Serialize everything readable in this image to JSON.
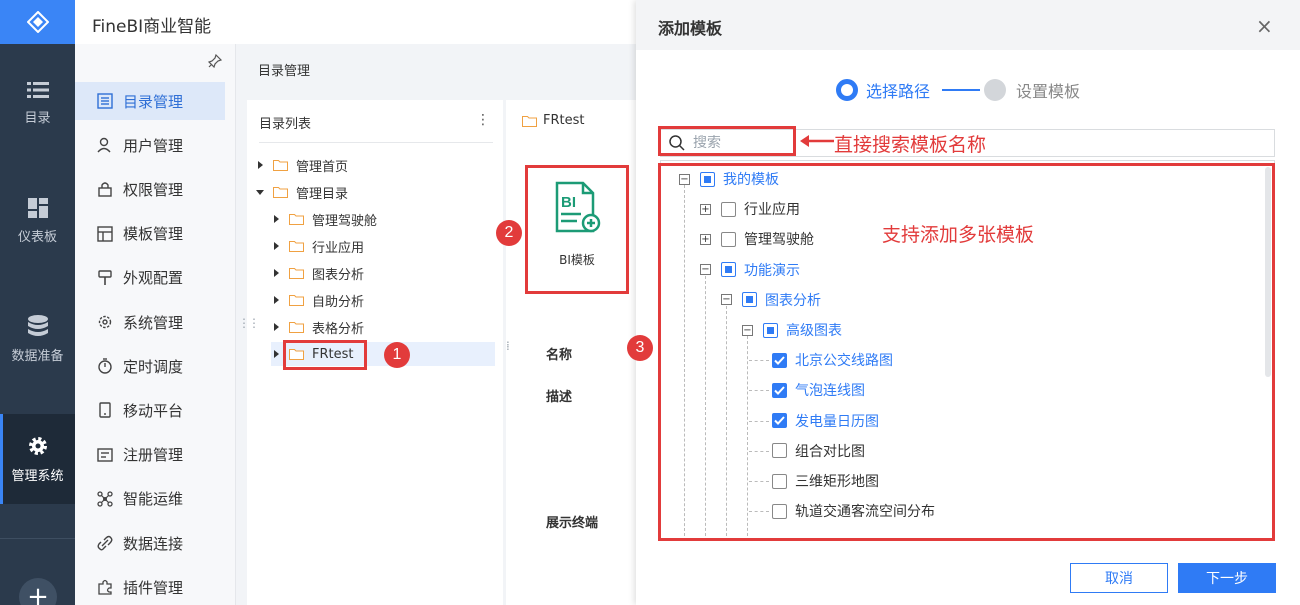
{
  "app": {
    "title": "FineBI商业智能"
  },
  "leftnav": {
    "items": [
      {
        "label": "目录",
        "icon": "list-icon"
      },
      {
        "label": "仪表板",
        "icon": "dashboard-icon"
      },
      {
        "label": "数据准备",
        "icon": "database-icon"
      },
      {
        "label": "管理系统",
        "icon": "gear-icon",
        "active": true
      }
    ],
    "add_label": "+"
  },
  "sidebar": {
    "items": [
      {
        "label": "目录管理",
        "icon": "catalog-icon",
        "active": true
      },
      {
        "label": "用户管理",
        "icon": "user-icon"
      },
      {
        "label": "权限管理",
        "icon": "lock-icon"
      },
      {
        "label": "模板管理",
        "icon": "template-icon"
      },
      {
        "label": "外观配置",
        "icon": "paint-icon"
      },
      {
        "label": "系统管理",
        "icon": "settings-icon"
      },
      {
        "label": "定时调度",
        "icon": "timer-icon"
      },
      {
        "label": "移动平台",
        "icon": "mobile-icon"
      },
      {
        "label": "注册管理",
        "icon": "register-icon"
      },
      {
        "label": "智能运维",
        "icon": "ops-icon"
      },
      {
        "label": "数据连接",
        "icon": "link-icon"
      },
      {
        "label": "插件管理",
        "icon": "plugin-icon"
      }
    ]
  },
  "main": {
    "breadcrumb": "目录管理",
    "list_title": "目录列表",
    "tree": [
      {
        "label": "管理首页",
        "level": 0,
        "expanded": false
      },
      {
        "label": "管理目录",
        "level": 0,
        "expanded": true
      },
      {
        "label": "管理驾驶舱",
        "level": 1,
        "expanded": false
      },
      {
        "label": "行业应用",
        "level": 1,
        "expanded": false
      },
      {
        "label": "图表分析",
        "level": 1,
        "expanded": false
      },
      {
        "label": "自助分析",
        "level": 1,
        "expanded": false
      },
      {
        "label": "表格分析",
        "level": 1,
        "expanded": false
      },
      {
        "label": "FRtest",
        "level": 1,
        "expanded": false,
        "selected": true
      }
    ],
    "detail": {
      "folder_name": "FRtest",
      "card_label": "BI模板",
      "field_name": "名称",
      "field_desc": "描述",
      "field_terminal": "展示终端"
    }
  },
  "dialog": {
    "title": "添加模板",
    "close_label": "×",
    "steps": [
      "选择路径",
      "设置模板"
    ],
    "search_placeholder": "搜索",
    "tree": [
      {
        "label": "我的模板",
        "level": 0,
        "toggle": "minus",
        "state": "partial",
        "blue": true
      },
      {
        "label": "行业应用",
        "level": 1,
        "toggle": "plus",
        "state": "unchecked"
      },
      {
        "label": "管理驾驶舱",
        "level": 1,
        "toggle": "plus",
        "state": "unchecked"
      },
      {
        "label": "功能演示",
        "level": 1,
        "toggle": "minus",
        "state": "partial",
        "blue": true
      },
      {
        "label": "图表分析",
        "level": 2,
        "toggle": "minus",
        "state": "partial",
        "blue": true
      },
      {
        "label": "高级图表",
        "level": 3,
        "toggle": "minus",
        "state": "partial",
        "blue": true
      },
      {
        "label": "北京公交线路图",
        "level": 4,
        "state": "checked",
        "blue": true
      },
      {
        "label": "气泡连线图",
        "level": 4,
        "state": "checked",
        "blue": true
      },
      {
        "label": "发电量日历图",
        "level": 4,
        "state": "checked",
        "blue": true
      },
      {
        "label": "组合对比图",
        "level": 4,
        "state": "unchecked"
      },
      {
        "label": "三维矩形地图",
        "level": 4,
        "state": "unchecked"
      },
      {
        "label": "轨道交通客流空间分布",
        "level": 4,
        "state": "unchecked"
      }
    ],
    "cancel_label": "取消",
    "next_label": "下一步"
  },
  "annotations": {
    "search_hint": "直接搜索模板名称",
    "multi_hint": "支持添加多张模板",
    "badges": [
      "1",
      "2",
      "3"
    ]
  },
  "colors": {
    "accent": "#2f7bf5",
    "annotation": "#e23b3b",
    "nav_bg": "#2b3a4c"
  }
}
